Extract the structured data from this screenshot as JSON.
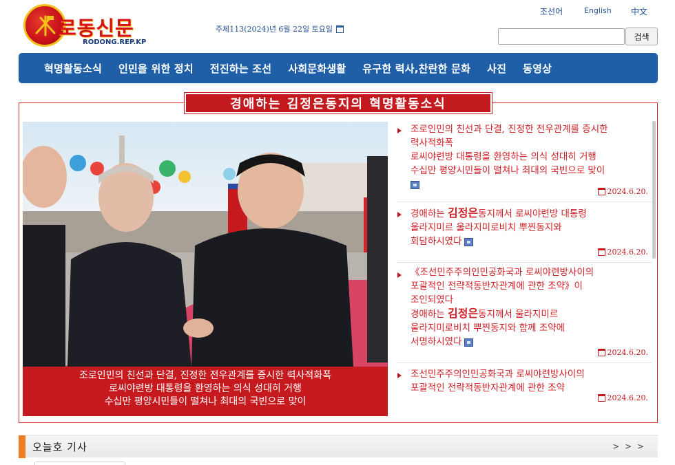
{
  "header": {
    "logo_text": "로동신문",
    "logo_url": "RODONG.REP.KP",
    "date": "주체113(2024)년 6월 22일 토요일",
    "languages": [
      "조선어",
      "English",
      "中文"
    ],
    "search_button": "검색",
    "search_value": ""
  },
  "nav": {
    "items": [
      "혁명활동소식",
      "인민을 위한 정치",
      "전진하는 조선",
      "사회문화생활",
      "유구한 력사,찬란한 문화",
      "사진",
      "동영상"
    ]
  },
  "feature": {
    "banner": "경애하는 김정은동지의 혁명활동소식",
    "caption_lines": [
      "조로인민의 친선과 단결, 진정한 전우관계를 증시한 력사적화폭",
      "로씨야련방 대통령을 환영하는 의식 성대히 거행",
      "수십만 평양시민들이 떨쳐나 최대의 국빈으로 맞이"
    ]
  },
  "articles": [
    {
      "lines": [
        "조로인민의 친선과 단결, 진정한 전우관계를 증시한",
        "력사적화폭",
        "로씨야련방 대통령을 환영하는 의식 성대히 거행",
        "수십만 평양시민들이 떨쳐나 최대의 국빈으로 맞이"
      ],
      "date": "2024.6.20."
    },
    {
      "line1_pre": "경애하는 ",
      "line1_big": "김정은",
      "line1_post": "동지께서 로씨야련방 대통령",
      "line2": "울라지미르 울라지미로비치 뿌찐동지와",
      "line3": "회담하시였다",
      "date": "2024.6.20."
    },
    {
      "line1": "《조선민주주의인민공화국과 로씨야련방사이의",
      "line2": "포괄적인 전략적동반자관계에 관한 조약》이",
      "line3": "조인되였다",
      "line4_pre": "경애하는 ",
      "line4_big": "김정은",
      "line4_post": "동지께서 울라지미르",
      "line5": "울라지미로비치 뿌찐동지와 함께 조약에",
      "line6": "서명하시였다",
      "date": "2024.6.20."
    },
    {
      "lines": [
        "조선민주주의인민공화국과 로씨야련방사이의",
        "포괄적인 전략적동반자관계에 관한 조약"
      ],
      "date": "2024.6.20."
    }
  ],
  "today": {
    "title": "오늘호 기사",
    "more": "> > >"
  },
  "colors": {
    "nav_blue": "#1f5fa8",
    "accent_red": "#c31a1f",
    "today_orange": "#ee7d22"
  }
}
